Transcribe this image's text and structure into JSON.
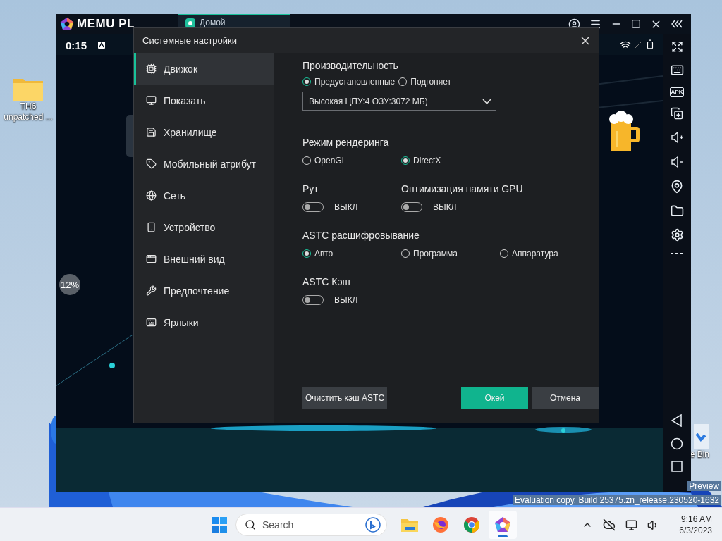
{
  "desktop": {
    "icons": [
      {
        "kind": "folder",
        "label": "TH6 unpatched ..."
      },
      {
        "kind": "bin",
        "label": "e Bin"
      }
    ],
    "build_notice": [
      "Preview",
      "Evaluation copy. Build 25375.zn_release.230520-1632"
    ]
  },
  "emulator": {
    "logo": "MEMU PL",
    "tab": "Домой",
    "clock": "0:15",
    "loading": "12%",
    "toolbar_apk": "APK"
  },
  "dialog": {
    "title": "Системные настройки",
    "sidebar": [
      {
        "label": "Движок",
        "selected": true
      },
      {
        "label": "Показать",
        "selected": false
      },
      {
        "label": "Хранилище",
        "selected": false
      },
      {
        "label": "Мобильный атрибут",
        "selected": false
      },
      {
        "label": "Сеть",
        "selected": false
      },
      {
        "label": "Устройство",
        "selected": false
      },
      {
        "label": "Внешний вид",
        "selected": false
      },
      {
        "label": "Предпочтение",
        "selected": false
      },
      {
        "label": "Ярлыки",
        "selected": false
      }
    ],
    "sections": [
      {
        "kind": "radio",
        "title": "Производительность",
        "options": [
          {
            "label": "Предустановленные",
            "selected": true
          },
          {
            "label": "Подгоняет",
            "selected": false
          }
        ],
        "select": {
          "value": "Высокая ЦПУ:4 ОЗУ:3072 МБ)"
        }
      },
      {
        "kind": "radio",
        "title": "Режим рендеринга",
        "options": [
          {
            "label": "OpenGL",
            "selected": false
          },
          {
            "label": "DirectX",
            "selected": true
          }
        ]
      },
      {
        "kind": "toggles",
        "items": [
          {
            "title": "Рут",
            "on": false,
            "state": "ВЫКЛ"
          },
          {
            "title": "Оптимизация памяти GPU",
            "on": false,
            "state": "ВЫКЛ"
          }
        ]
      },
      {
        "kind": "radio",
        "title": "ASTC расшифровывание",
        "options": [
          {
            "label": "Авто",
            "selected": true
          },
          {
            "label": "Программа",
            "selected": false
          },
          {
            "label": "Аппаратура",
            "selected": false
          }
        ]
      },
      {
        "kind": "toggles",
        "items": [
          {
            "title": "ASTC Кэш",
            "on": false,
            "state": "ВЫКЛ"
          }
        ]
      }
    ],
    "buttons": [
      {
        "kind": "secondary",
        "label": "Очистить кэш ASTC"
      },
      {
        "kind": "primary",
        "label": "Окей"
      },
      {
        "kind": "secondary",
        "label": "Отмена"
      }
    ]
  },
  "taskbar": {
    "search": {
      "placeholder": "Search"
    },
    "apps": [
      {
        "kind": "files",
        "active": false
      },
      {
        "kind": "firefox",
        "active": false
      },
      {
        "kind": "chrome",
        "active": false
      },
      {
        "kind": "memu",
        "active": true
      }
    ],
    "time": "9:16 AM",
    "date": "6/3/2023"
  }
}
